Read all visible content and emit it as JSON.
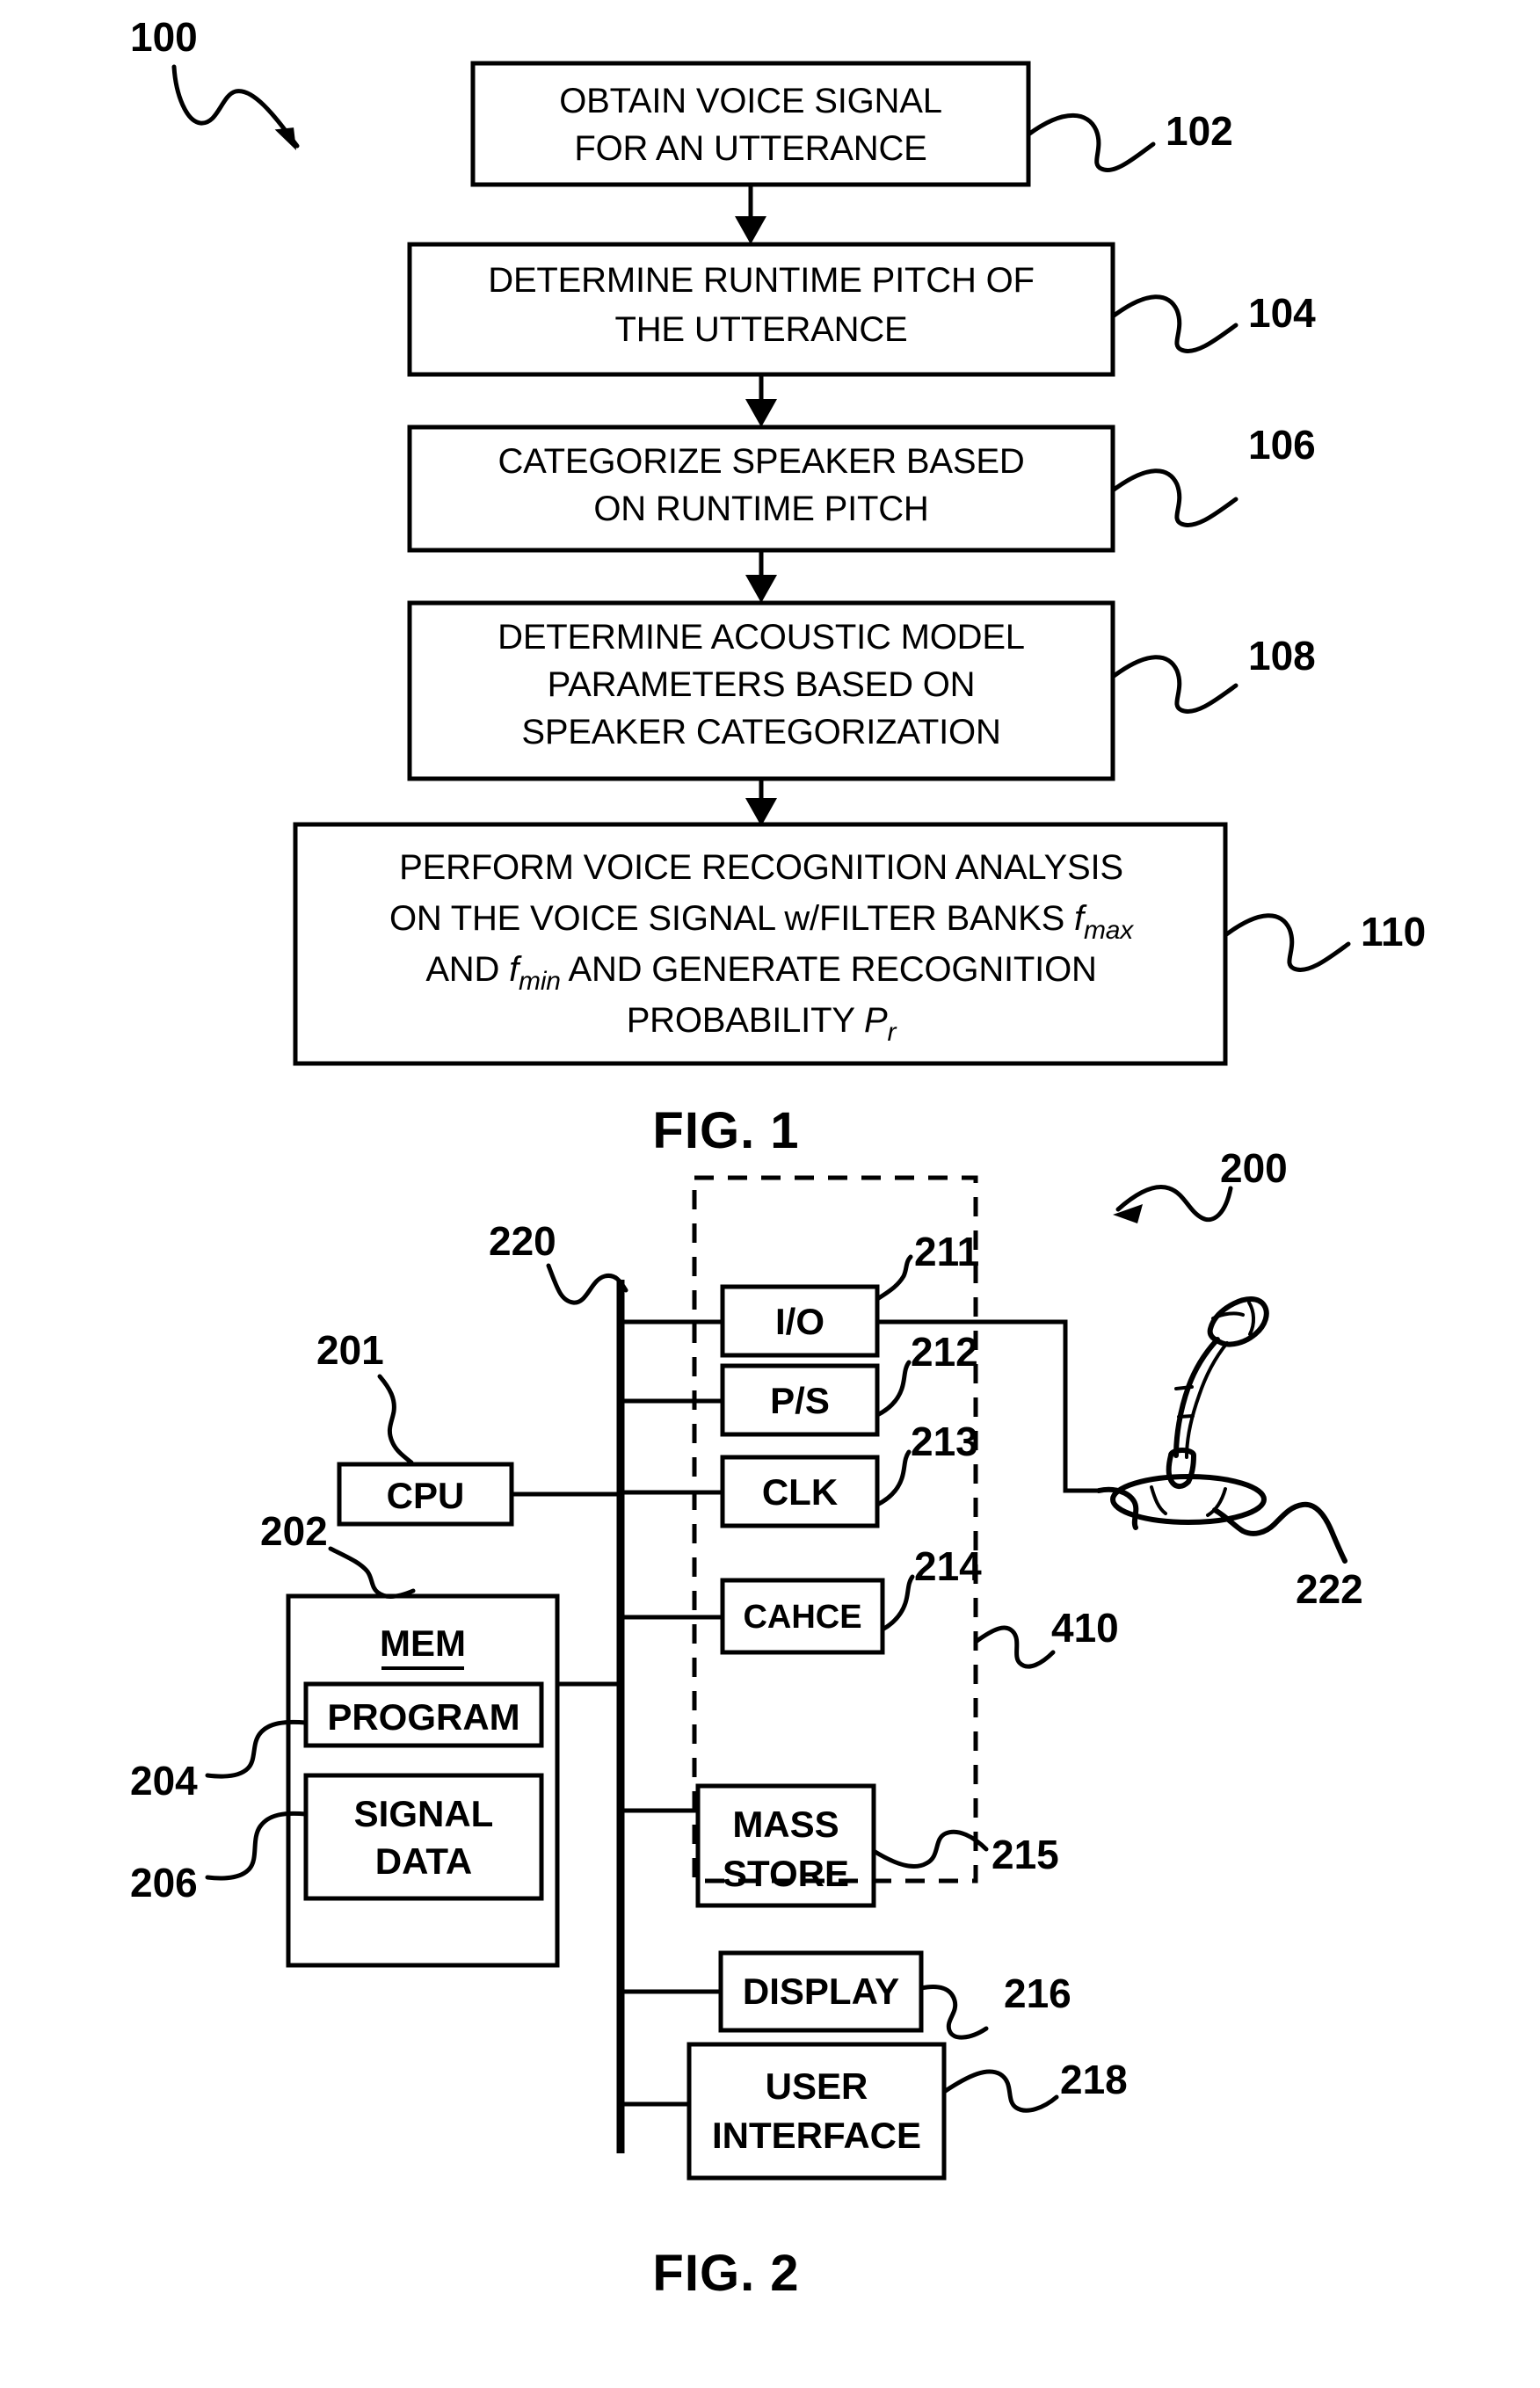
{
  "document": {
    "type": "patent-figure-sheet",
    "figures": [
      "FIG. 1",
      "FIG. 2"
    ]
  },
  "fig1": {
    "caption": "FIG. 1",
    "diagram_ref": "100",
    "steps": [
      {
        "ref": "102",
        "lines": [
          "OBTAIN VOICE SIGNAL",
          "FOR AN UTTERANCE"
        ]
      },
      {
        "ref": "104",
        "lines": [
          "DETERMINE RUNTIME PITCH OF",
          "THE UTTERANCE"
        ]
      },
      {
        "ref": "106",
        "lines": [
          "CATEGORIZE SPEAKER BASED",
          "ON RUNTIME PITCH"
        ]
      },
      {
        "ref": "108",
        "lines": [
          "DETERMINE ACOUSTIC MODEL",
          "PARAMETERS BASED ON",
          "SPEAKER CATEGORIZATION"
        ]
      },
      {
        "ref": "110",
        "lines_rich": [
          "PERFORM VOICE RECOGNITION ANALYSIS",
          "ON THE VOICE SIGNAL w/FILTER BANKS f_max",
          "AND f_min AND GENERATE RECOGNITION",
          "PROBABILITY P_r"
        ],
        "line1": "PERFORM VOICE RECOGNITION ANALYSIS",
        "line2_a": "ON THE VOICE SIGNAL w/FILTER BANKS ",
        "line2_sym": "f",
        "line2_sub": "max",
        "line3_a": "AND ",
        "line3_sym": "f",
        "line3_sub": "min",
        "line3_b": " AND GENERATE RECOGNITION",
        "line4_a": "PROBABILITY ",
        "line4_sym": "P",
        "line4_sub": "r"
      }
    ]
  },
  "fig2": {
    "caption": "FIG. 2",
    "diagram_ref": "200",
    "bus_ref": "220",
    "dashed_group_ref": "410",
    "components": [
      {
        "ref": "201",
        "label": "CPU"
      },
      {
        "ref": "211",
        "label": "I/O"
      },
      {
        "ref": "212",
        "label": "P/S"
      },
      {
        "ref": "213",
        "label": "CLK"
      },
      {
        "ref": "214",
        "label": "CAHCE"
      },
      {
        "ref": "215",
        "label_l1": "MASS",
        "label_l2": "STORE"
      },
      {
        "ref": "216",
        "label": "DISPLAY"
      },
      {
        "ref": "218",
        "label_l1": "USER",
        "label_l2": "INTERFACE"
      }
    ],
    "memory": {
      "ref": "202",
      "title": "MEM",
      "program": {
        "ref": "204",
        "label": "PROGRAM"
      },
      "signal_data": {
        "ref": "206",
        "label_l1": "SIGNAL",
        "label_l2": "DATA"
      }
    },
    "microphone": {
      "ref": "222",
      "icon": "microphone-icon"
    }
  },
  "colors": {
    "ink": "#000000",
    "paper": "#ffffff"
  }
}
